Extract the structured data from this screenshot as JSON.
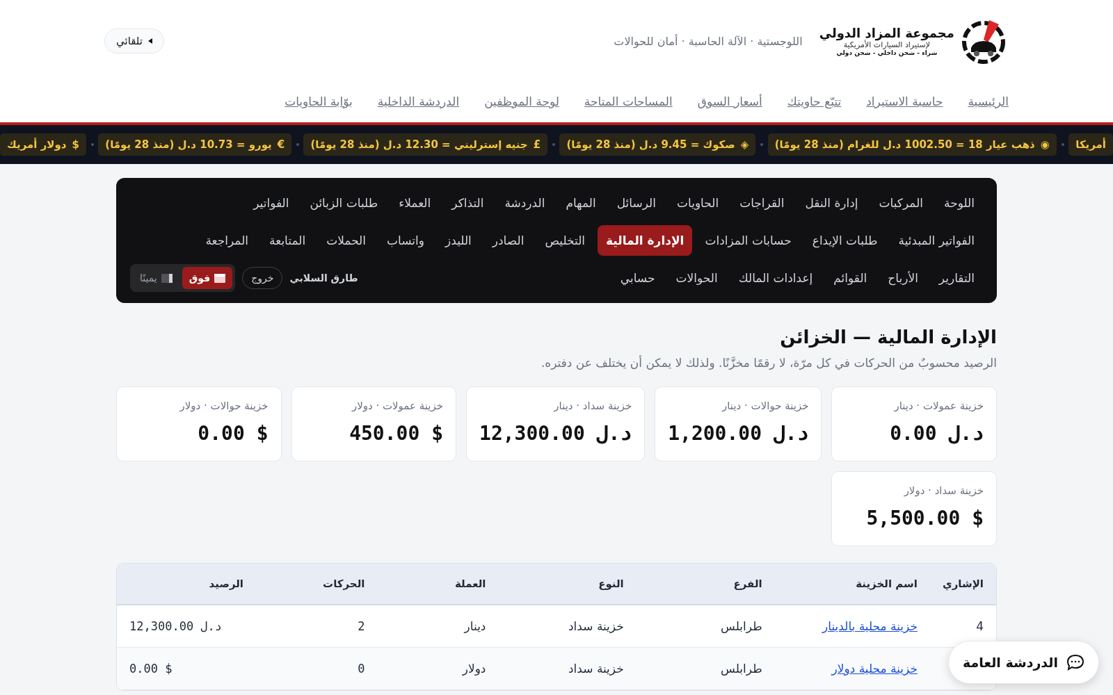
{
  "header": {
    "logo": {
      "title": "مجموعة المزاد الدولي",
      "subtitle": "لإستيراد السيارات الأمريكية",
      "tagline": "شراء - شحن داخلي - شحن دولي"
    },
    "slogan": "اللوجستية · الآلة الحاسبة · أمان للحوالات",
    "theme_button": {
      "label": "تلقائي"
    }
  },
  "site_nav": [
    {
      "label": "الرئيسية"
    },
    {
      "label": "حاسبة الاستيراد"
    },
    {
      "label": "تتبّع حاويتك"
    },
    {
      "label": "أسعار السوق"
    },
    {
      "label": "المساحات المتاحة"
    },
    {
      "label": "لوحة الموظفين"
    },
    {
      "label": "الدردشة الداخلية"
    },
    {
      "label": "بوّابة الحاويات"
    }
  ],
  "ticker": [
    {
      "text": "أمريكا"
    },
    {
      "symbol": "◉",
      "text": "ذهب عيار 18 = 1002.50 د.ل للغرام (منذ 28 يومًا)"
    },
    {
      "symbol": "◈",
      "text": "صكوك = 9.45 د.ل (منذ 28 يومًا)"
    },
    {
      "symbol": "£",
      "text": "جنيه إسترليني = 12.30 د.ل (منذ 28 يومًا)"
    },
    {
      "symbol": "€",
      "text": "يورو = 10.73 د.ل (منذ 28 يومًا)"
    },
    {
      "symbol": "$",
      "text": "دولار أمريك"
    }
  ],
  "admin_nav": {
    "groups": [
      {
        "items": [
          {
            "label": "اللوحة",
            "selected": false
          },
          {
            "label": "المركبات",
            "selected": false
          },
          {
            "label": "إدارة النقل",
            "selected": false
          },
          {
            "label": "القراجات",
            "selected": false
          },
          {
            "label": "الحاويات",
            "selected": false
          },
          {
            "label": "الرسائل",
            "selected": false
          },
          {
            "label": "المهام",
            "selected": false
          },
          {
            "label": "الدردشة",
            "selected": false
          },
          {
            "label": "التذاكر",
            "selected": false
          },
          {
            "label": "العملاء",
            "selected": false
          },
          {
            "label": "طلبات الزبائن",
            "selected": false
          },
          {
            "label": "الفواتير",
            "selected": false
          }
        ]
      },
      {
        "items": [
          {
            "label": "الفواتير المبدئية",
            "selected": false
          },
          {
            "label": "طلبات الإيداع",
            "selected": false
          },
          {
            "label": "حسابات المزادات",
            "selected": false
          },
          {
            "label": "الإدارة المالية",
            "selected": true
          },
          {
            "label": "التخليص",
            "selected": false
          },
          {
            "label": "الصادر",
            "selected": false
          },
          {
            "label": "الليدز",
            "selected": false
          },
          {
            "label": "واتساب",
            "selected": false
          },
          {
            "label": "الحملات",
            "selected": false
          },
          {
            "label": "المتابعة",
            "selected": false
          },
          {
            "label": "المراجعة",
            "selected": false
          }
        ]
      },
      {
        "items": [
          {
            "label": "التقارير",
            "selected": false
          },
          {
            "label": "الأرباح",
            "selected": false
          },
          {
            "label": "القوائم",
            "selected": false
          },
          {
            "label": "إعدادات المالك",
            "selected": false
          },
          {
            "label": "الحوالات",
            "selected": false
          },
          {
            "label": "حسابي",
            "selected": false
          }
        ]
      }
    ],
    "user": "طارق السلابي",
    "logout": "خروج",
    "layout_options": [
      {
        "label": "فوق",
        "kind": "top",
        "selected": true
      },
      {
        "label": "يمينًا",
        "kind": "side",
        "selected": false
      }
    ]
  },
  "page": {
    "title": "الإدارة المالية — الخزائن",
    "subtitle": "الرصيد محسوبٌ من الحركات في كل مرّة، لا رقمًا مخزَّنًا. ولذلك لا يمكن أن يختلف عن دفتره."
  },
  "vaults": [
    {
      "label": "خزينة عمولات · دينار",
      "value": "د.ل 0.00"
    },
    {
      "label": "خزينة حوالات · دينار",
      "value": "د.ل 1,200.00"
    },
    {
      "label": "خزينة سداد · دينار",
      "value": "د.ل 12,300.00"
    },
    {
      "label": "خزينة عمولات · دولار",
      "value": "$ 450.00"
    },
    {
      "label": "خزينة حوالات · دولار",
      "value": "$ 0.00"
    },
    {
      "label": "خزينة سداد · دولار",
      "value": "$ 5,500.00"
    }
  ],
  "table": {
    "columns": [
      "الإشاري",
      "اسم الخزينة",
      "الفرع",
      "النوع",
      "العملة",
      "الحركات",
      "الرصيد"
    ],
    "rows": [
      {
        "ref": "4",
        "name": "خزينة محلية بالدينار",
        "branch": "طرابلس",
        "type": "خزينة سداد",
        "currency": "دينار",
        "movements": "2",
        "balance": "12,300.00 د.ل"
      },
      {
        "name": "خزينة محلية دولار",
        "branch": "طرابلس",
        "type": "خزينة سداد",
        "currency": "دولار",
        "movements": "0",
        "balance": "0.00 $"
      }
    ]
  },
  "chat_button": {
    "label": "الدردشة العامة"
  }
}
